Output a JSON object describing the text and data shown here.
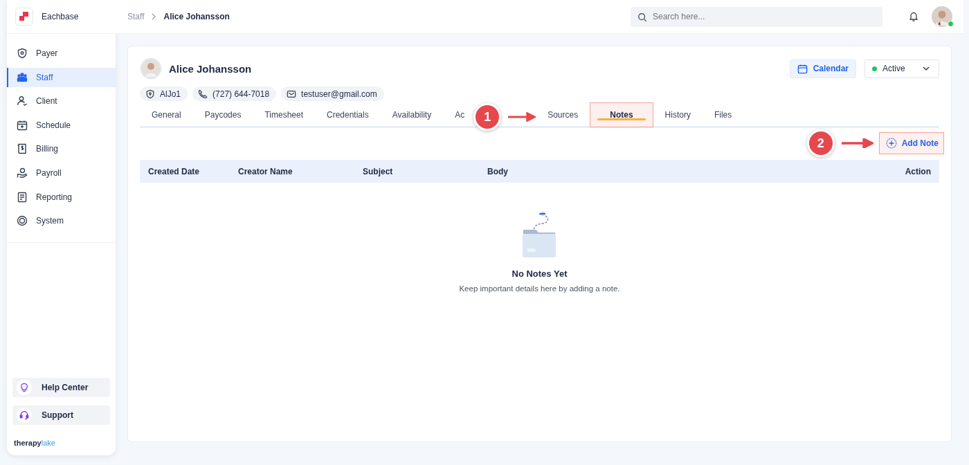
{
  "app": {
    "name": "Eachbase"
  },
  "sidebar": {
    "items": [
      {
        "label": "Payer",
        "kind": "shield",
        "selected": false
      },
      {
        "label": "Staff",
        "kind": "people",
        "selected": true
      },
      {
        "label": "Client",
        "kind": "person",
        "selected": false
      },
      {
        "label": "Schedule",
        "kind": "calendar",
        "selected": false
      },
      {
        "label": "Billing",
        "kind": "receipt",
        "selected": false
      },
      {
        "label": "Payroll",
        "kind": "hand",
        "selected": false
      },
      {
        "label": "Reporting",
        "kind": "report",
        "selected": false
      },
      {
        "label": "System",
        "kind": "ring",
        "selected": false
      }
    ],
    "bottom": [
      {
        "label": "Help Center",
        "kind": "bulb"
      },
      {
        "label": "Support",
        "kind": "headset"
      }
    ],
    "brand": {
      "first": "therapy",
      "second": "lake"
    }
  },
  "breadcrumb": [
    "Staff",
    "Alice Johansson"
  ],
  "search": {
    "placeholder": "Search here..."
  },
  "user": {
    "online": true
  },
  "profile": {
    "name": "Alice Johansson",
    "chips": [
      {
        "kind": "shield",
        "text": "AlJo1"
      },
      {
        "kind": "phone",
        "text": "(727) 644-7018"
      },
      {
        "kind": "mail",
        "text": "testuser@gmail.com"
      }
    ],
    "calendar_button": "Calendar",
    "status": {
      "label": "Active",
      "color": "#22c55e"
    }
  },
  "tabs": [
    {
      "label": "General",
      "selected": false,
      "highlighted": false
    },
    {
      "label": "Paycodes",
      "selected": false,
      "highlighted": false
    },
    {
      "label": "Timesheet",
      "selected": false,
      "highlighted": false
    },
    {
      "label": "Credentials",
      "selected": false,
      "highlighted": false
    },
    {
      "label": "Availability",
      "selected": false,
      "highlighted": false
    },
    {
      "label": "Ac",
      "selected": false,
      "highlighted": false
    },
    {
      "label": "Sources",
      "selected": false,
      "highlighted": false
    },
    {
      "label": "Notes",
      "selected": true,
      "highlighted": true
    },
    {
      "label": "History",
      "selected": false,
      "highlighted": false
    },
    {
      "label": "Files",
      "selected": false,
      "highlighted": false
    }
  ],
  "add_note": {
    "label": "Add Note",
    "highlighted": true
  },
  "table": {
    "columns": [
      "Created Date",
      "Creator Name",
      "Subject",
      "Body",
      "Action"
    ]
  },
  "empty": {
    "title": "No Notes Yet",
    "text": "Keep important details here by adding a note."
  },
  "annotations": [
    {
      "number": "1"
    },
    {
      "number": "2"
    }
  ]
}
